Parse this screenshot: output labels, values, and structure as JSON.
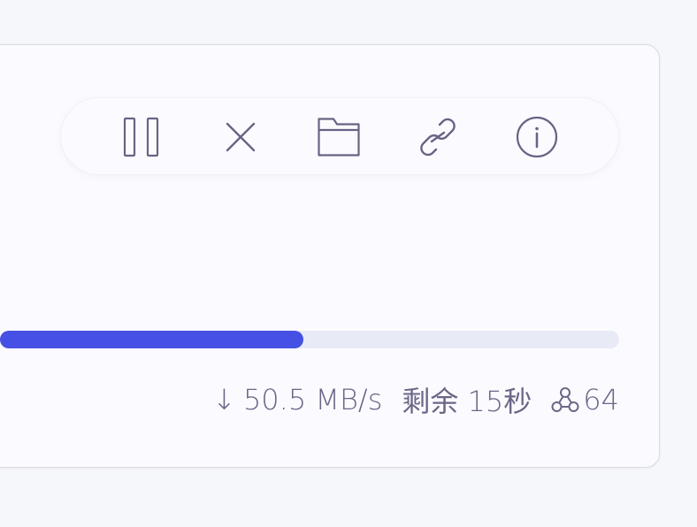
{
  "toolbar": {
    "buttons": [
      {
        "id": "pause",
        "icon": "pause-icon"
      },
      {
        "id": "cancel",
        "icon": "close-icon"
      },
      {
        "id": "open-folder",
        "icon": "folder-icon"
      },
      {
        "id": "copy-link",
        "icon": "link-icon"
      },
      {
        "id": "info",
        "icon": "info-icon"
      }
    ],
    "icon_color": "#6b6285"
  },
  "progress": {
    "fraction": 0.49,
    "fill_color": "#4650e4",
    "track_color": "#e8ebf6"
  },
  "stats": {
    "arrow": "↓",
    "speed": "50.5 MB/s",
    "remaining": "剩余 15秒",
    "peers_icon": "peers-icon",
    "peers": "64"
  }
}
